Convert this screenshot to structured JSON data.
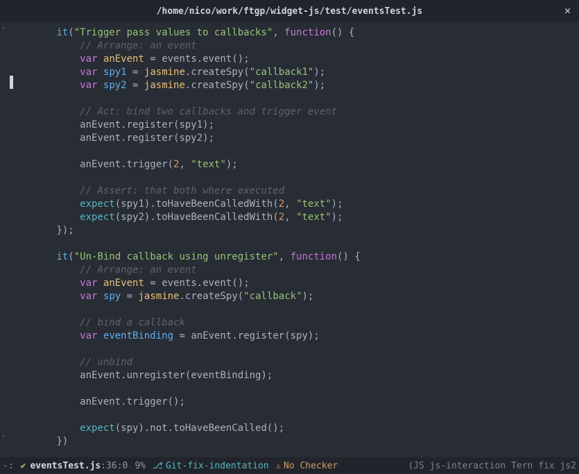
{
  "title": "/home/nico/work/ftgp/widget-js/test/eventsTest.js",
  "code": {
    "it1_desc": "\"Trigger pass values to callbacks\"",
    "it2_desc": "\"Un-Bind callback using unregister\"",
    "c_arrange": "// Arrange: an event",
    "c_act": "// Act: bind two callbacks and trigger event",
    "c_assert": "// Assert: that both where executed",
    "c_bind": "// bind a callback",
    "c_unbind": "// unbind",
    "kw_var": "var",
    "kw_function": "function",
    "anEvent": "anEvent",
    "spy1": "spy1",
    "spy2": "spy2",
    "spy": "spy",
    "eventBinding": "eventBinding",
    "jasmine": "jasmine",
    "events_event": "events.event();",
    "createSpy": ".createSpy(",
    "cb1": "\"callback1\"",
    "cb2": "\"callback2\"",
    "cb": "\"callback\"",
    "register_spy1": "anEvent.register(spy1);",
    "register_spy2": "anEvent.register(spy2);",
    "register_spy": "anEvent.register(spy);",
    "trigger_args": "anEvent.trigger(",
    "trigger_noargs": "anEvent.trigger();",
    "unregister": "anEvent.unregister(eventBinding);",
    "two": "2",
    "text": "\"text\"",
    "expect": "expect",
    "toHaveBeenCalledWith": ").toHaveBeenCalledWith(",
    "not_toHaveBeenCalled": "(spy).not.toHaveBeenCalled();",
    "close_test": "});",
    "close_last": "})",
    "it": "it",
    "paren_open": "(",
    "paren_close": ")",
    "comma_sp": ", ",
    "func_sig": "() {",
    "eq": " = ",
    "close_paren_semi": ");",
    "semi": ";"
  },
  "modeline": {
    "mod": "-:",
    "check": "✔",
    "filename": "eventsTest.js",
    "pos": ":36:0",
    "percent": "9%",
    "branch_icon": "⎇",
    "branch": "Git-fix-indentation",
    "warn_icon": "⚠",
    "checker": "No Checker",
    "right": "(JS js-interaction Tern fix js2"
  },
  "close_btn": "✕"
}
